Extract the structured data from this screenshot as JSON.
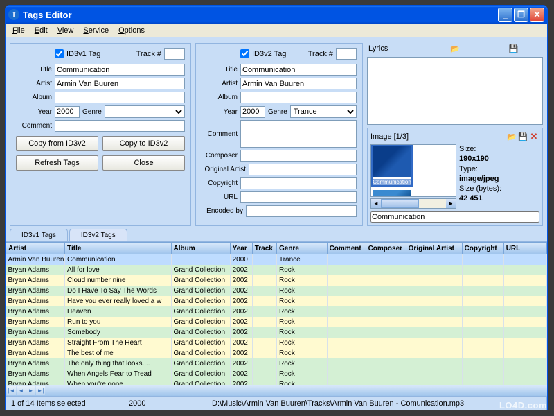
{
  "window": {
    "title": "Tags Editor"
  },
  "menu": {
    "file": "File",
    "edit": "Edit",
    "view": "View",
    "service": "Service",
    "options": "Options"
  },
  "v1": {
    "tag_label": "ID3v1 Tag",
    "track_label": "Track #",
    "track": "",
    "title_label": "Title",
    "title": "Communication",
    "artist_label": "Artist",
    "artist": "Armin Van Buuren",
    "album_label": "Album",
    "album": "",
    "year_label": "Year",
    "year": "2000",
    "genre_label": "Genre",
    "genre": "",
    "comment_label": "Comment",
    "comment": "",
    "btn_copy_from": "Copy from ID3v2",
    "btn_copy_to": "Copy to ID3v2",
    "btn_refresh": "Refresh Tags",
    "btn_close": "Close"
  },
  "v2": {
    "tag_label": "ID3v2 Tag",
    "track_label": "Track #",
    "track": "",
    "title_label": "Title",
    "title": "Communication",
    "artist_label": "Artist",
    "artist": "Armin Van Buuren",
    "album_label": "Album",
    "album": "",
    "year_label": "Year",
    "year": "2000",
    "genre_label": "Genre",
    "genre": "Trance",
    "comment_label": "Comment",
    "comment": "",
    "composer_label": "Composer",
    "composer": "",
    "origartist_label": "Original Artist",
    "origartist": "",
    "copyright_label": "Copyright",
    "copyright": "",
    "url_label": "URL",
    "url": "",
    "encodedby_label": "Encoded by",
    "encodedby": ""
  },
  "lyrics": {
    "label": "Lyrics",
    "text": ""
  },
  "image": {
    "label": "Image [1/3]",
    "size_label": "Size:",
    "size": "190x190",
    "type_label": "Type:",
    "type": "image/jpeg",
    "bytes_label": "Size (bytes):",
    "bytes": "42 451",
    "caption1": "Communication",
    "caption2": "",
    "desc": "Communication"
  },
  "tabs": {
    "t1": "ID3v1 Tags",
    "t2": "ID3v2 Tags"
  },
  "cols": {
    "artist": "Artist",
    "title": "Title",
    "album": "Album",
    "year": "Year",
    "track": "Track",
    "genre": "Genre",
    "comment": "Comment",
    "composer": "Composer",
    "origartist": "Original Artist",
    "copyright": "Copyright",
    "url": "URL"
  },
  "rows": [
    {
      "cls": "sel",
      "artist": "Armin Van Buuren",
      "title": "Communication",
      "album": "",
      "year": "2000",
      "track": "",
      "genre": "Trance"
    },
    {
      "cls": "g",
      "artist": "Bryan Adams",
      "title": "All for love",
      "album": "Grand Collection",
      "year": "2002",
      "track": "",
      "genre": "Rock"
    },
    {
      "cls": "y",
      "artist": "Bryan Adams",
      "title": "Cloud number nine",
      "album": "Grand Collection",
      "year": "2002",
      "track": "",
      "genre": "Rock"
    },
    {
      "cls": "g",
      "artist": "Bryan Adams",
      "title": "Do I Have To Say The Words",
      "album": "Grand Collection",
      "year": "2002",
      "track": "",
      "genre": "Rock"
    },
    {
      "cls": "y",
      "artist": "Bryan Adams",
      "title": "Have you ever really loved a w",
      "album": "Grand Collection",
      "year": "2002",
      "track": "",
      "genre": "Rock"
    },
    {
      "cls": "g",
      "artist": "Bryan Adams",
      "title": "Heaven",
      "album": "Grand Collection",
      "year": "2002",
      "track": "",
      "genre": "Rock"
    },
    {
      "cls": "y",
      "artist": "Bryan Adams",
      "title": "Run to you",
      "album": "Grand Collection",
      "year": "2002",
      "track": "",
      "genre": "Rock"
    },
    {
      "cls": "g",
      "artist": "Bryan Adams",
      "title": "Somebody",
      "album": "Grand Collection",
      "year": "2002",
      "track": "",
      "genre": "Rock"
    },
    {
      "cls": "y",
      "artist": "Bryan Adams",
      "title": "Straight From The Heart",
      "album": "Grand Collection",
      "year": "2002",
      "track": "",
      "genre": "Rock"
    },
    {
      "cls": "y",
      "artist": "Bryan Adams",
      "title": "The best of me",
      "album": "Grand Collection",
      "year": "2002",
      "track": "",
      "genre": "Rock"
    },
    {
      "cls": "g",
      "artist": "Bryan Adams",
      "title": "The  only thing that looks....",
      "album": "Grand Collection",
      "year": "2002",
      "track": "",
      "genre": "Rock"
    },
    {
      "cls": "g",
      "artist": "Bryan Adams",
      "title": "When Angels Fear to Tread",
      "album": "Grand Collection",
      "year": "2002",
      "track": "",
      "genre": "Rock"
    },
    {
      "cls": "g",
      "artist": "Bryan Adams",
      "title": "When you're gone",
      "album": "Grand Collection",
      "year": "2002",
      "track": "",
      "genre": "Rock"
    }
  ],
  "status": {
    "sel": "1 of 14 Items selected",
    "year": "2000",
    "path": "D:\\Music\\Armin Van Buuren\\Tracks\\Armin Van Buuren - Comunication.mp3"
  },
  "watermark": "LO4D.com"
}
